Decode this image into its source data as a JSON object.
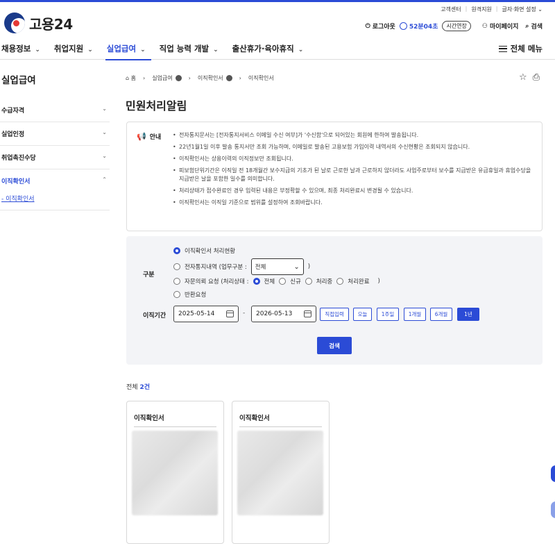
{
  "util_links": [
    "고객센터",
    "원격지원",
    "글자·화면 설정"
  ],
  "logo_text": "고용24",
  "header": {
    "logout": "로그아웃",
    "timer": "52분04초",
    "extend": "시간연장",
    "mypage": "마이페이지",
    "search": "검색"
  },
  "gnb": {
    "items": [
      "채용정보",
      "취업지원",
      "실업급여",
      "직업 능력 개발",
      "출산휴가·육아휴직"
    ],
    "active_index": 2,
    "all_menu": "전체 메뉴"
  },
  "lnb": {
    "title": "실업급여",
    "items": [
      "수급자격",
      "실업인정",
      "취업촉진수당",
      "이직확인서"
    ],
    "sub": "- 이직확인서"
  },
  "breadcrumb": [
    "홈",
    "실업급여",
    "이직확인서",
    "이직확인서"
  ],
  "page_title": "민원처리알림",
  "notice": {
    "label": "안내",
    "lines": [
      "전자통지문서는 [전자통지서비스 이메일 수신 여부]가 '수신함'으로 되어있는 회원에 한하여 발송됩니다.",
      "22년1월1일 이후 발송 통지서만 조회 가능하며, 이메일로 발송된 고용보험 가입이력 내역서의 수신현황은 조회되지 않습니다.",
      "이직확인서는 상용이력의 이직정보만 조회됩니다.",
      "피보험단위기간은 이직일 전 18개월간 보수지급의 기초가 된 날로 근로한 날과 근로하지 않더라도 사업주로부터 보수를 지급받은 유급휴일과 휴업수당을 지급받은 날을 포함한 일수를 의미합니다.",
      "처리상태가 접수완료인 경우 입력된 내용은 부정확할 수 있으며, 최종 처리완료시 변경될 수 있습니다.",
      "이직확인서는 이직일 기준으로 범위를 설정하여 조회바랍니다."
    ]
  },
  "search": {
    "label_type": "구분",
    "opt1": "이직확인서 처리현황",
    "opt2_prefix": "전자통지내역 (업무구분 :",
    "opt2_select": "전체",
    "opt2_suffix": ")",
    "opt3_prefix": "자문의뢰 요청 (처리상태 :",
    "opt3_choices": [
      "전체",
      "신규",
      "처리중",
      "처리완료"
    ],
    "opt3_suffix": ")",
    "opt4": "반환요청",
    "label_period": "이직기간",
    "date_from": "2025-05-14",
    "date_to": "2026-05-13",
    "period_buttons": [
      "직접입력",
      "오늘",
      "1주일",
      "1개월",
      "6개월",
      "1년"
    ],
    "submit": "검색"
  },
  "total": {
    "prefix": "전체",
    "count": "2건"
  },
  "cards": [
    {
      "title": "이직확인서"
    },
    {
      "title": "이직확인서"
    }
  ],
  "colors": {
    "accent": "#2b4bd6",
    "brand_red": "#e53935",
    "brand_navy": "#1a3a8a"
  }
}
